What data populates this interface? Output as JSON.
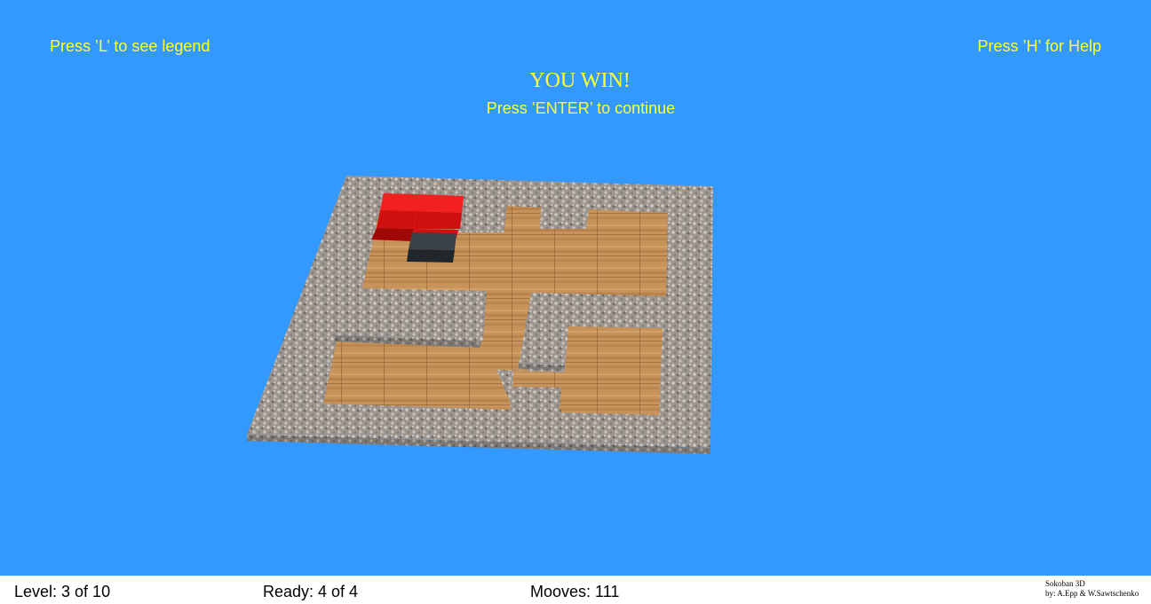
{
  "hud": {
    "legend_hint": "Press ’L’ to see legend",
    "help_hint": "Press ’H’ for Help",
    "win_title": "YOU WIN!",
    "continue_hint": "Press ’ENTER’ to continue"
  },
  "status": {
    "level": "Level: 3 of 10",
    "ready": "Ready: 4 of 4",
    "moves": "Mooves: 111",
    "credits_line1": "Sokoban 3D",
    "credits_line2": "by: A.Epp & W.Sawtschenko"
  },
  "colors": {
    "background": "#3399FF",
    "hud_text": "#FFFF33",
    "stone_wall": "#9C9590",
    "wood_floor": "#C8935A",
    "box_on_goal": "#E01010",
    "player": "#2E3438"
  }
}
